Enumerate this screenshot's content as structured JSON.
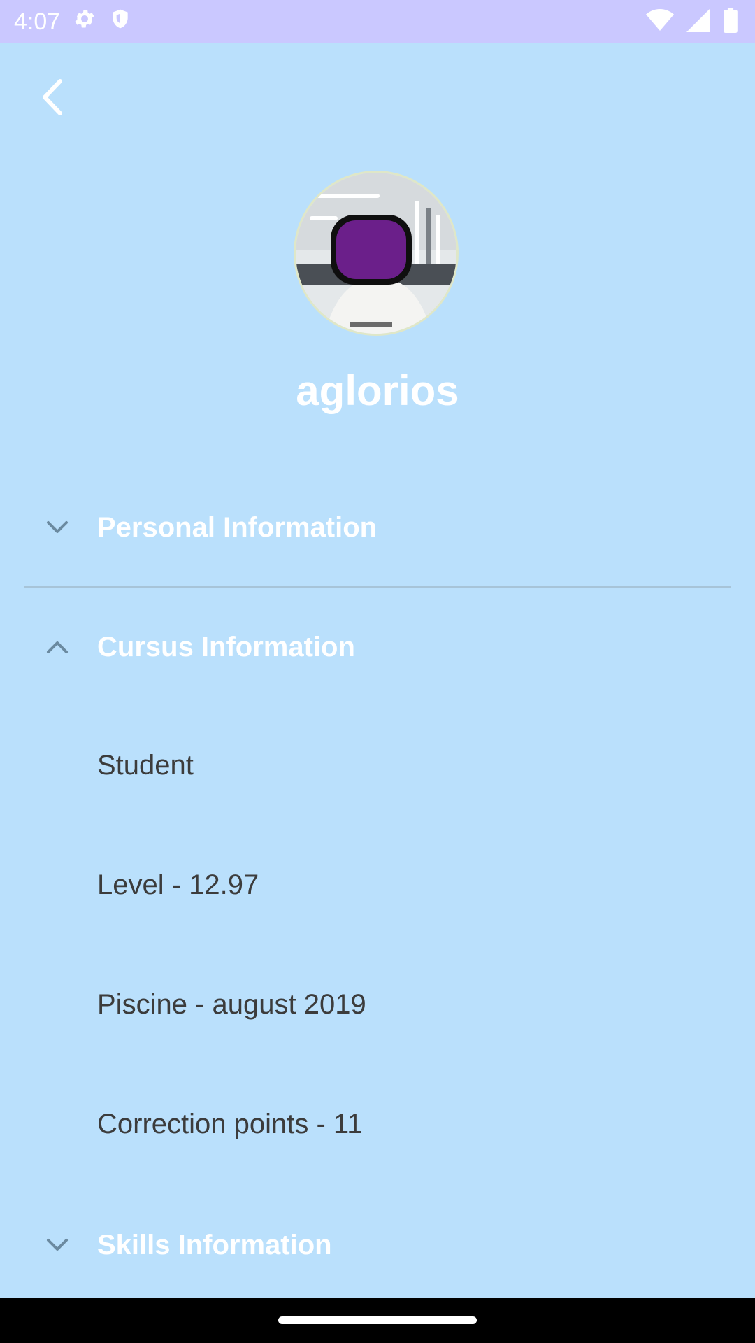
{
  "status_bar": {
    "time": "4:07",
    "icons": [
      "gear-icon",
      "shield-icon",
      "wifi-icon",
      "signal-icon",
      "battery-icon"
    ]
  },
  "header": {
    "back_icon": "chevron-left-icon"
  },
  "profile": {
    "username": "aglorios"
  },
  "sections": {
    "personal": {
      "label": "Personal Information",
      "expanded": false
    },
    "cursus": {
      "label": "Cursus Information",
      "expanded": true,
      "items": [
        "Student",
        "Level - 12.97",
        "Piscine - august 2019",
        "Correction points - 11"
      ]
    },
    "skills": {
      "label": "Skills Information",
      "expanded": false
    }
  },
  "colors": {
    "background": "#BAE0FC",
    "status_bar": "#CAC8FF",
    "header_text": "#FFFFFF",
    "item_text": "#3C3C3C",
    "avatar_redaction": "#6B1F8A"
  }
}
